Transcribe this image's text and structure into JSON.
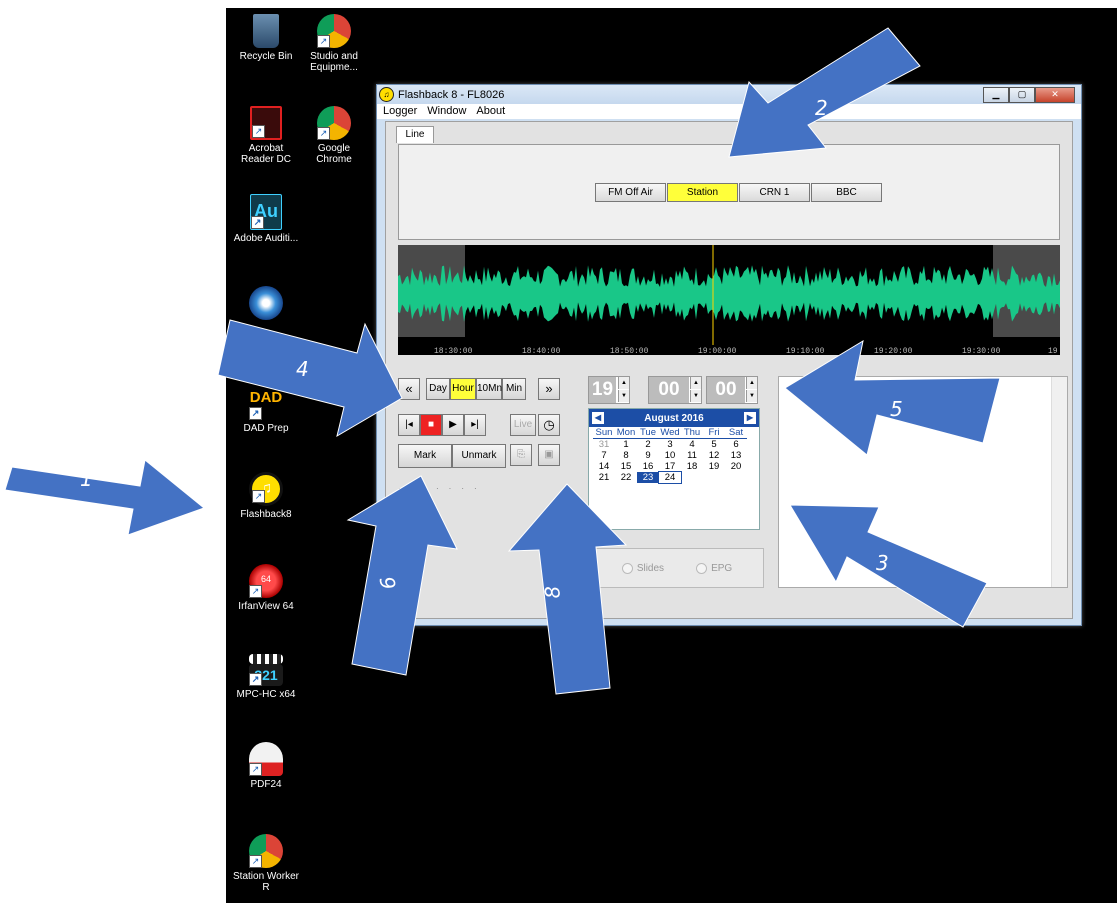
{
  "desktop": {
    "icons": [
      {
        "label": "Recycle Bin",
        "icon": "recycle-bin-icon"
      },
      {
        "label": "Studio and Equipme...",
        "icon": "chrome-icon"
      },
      {
        "label": "Acrobat Reader DC",
        "icon": "acrobat-icon"
      },
      {
        "label": "Google Chrome",
        "icon": "chrome-icon"
      },
      {
        "label": "Adobe Auditi...",
        "icon": "audition-icon"
      },
      {
        "label": "DAD Prep",
        "icon": "dad-icon"
      },
      {
        "label": "Flashback8",
        "icon": "flashback-icon"
      },
      {
        "label": "IrfanView 64",
        "icon": "irfanview-icon"
      },
      {
        "label": "MPC-HC x64",
        "icon": "mpc-icon"
      },
      {
        "label": "PDF24",
        "icon": "pdf24-icon"
      },
      {
        "label": "Station Worker R",
        "icon": "chrome-icon"
      }
    ]
  },
  "window": {
    "title": "Flashback 8 - FL8026",
    "menu": [
      "Logger",
      "Window",
      "About"
    ],
    "tab": "Line",
    "sources": [
      {
        "label": "FM Off Air",
        "active": false
      },
      {
        "label": "Station",
        "active": true
      },
      {
        "label": "CRN 1",
        "active": false
      },
      {
        "label": "BBC",
        "active": false
      }
    ],
    "timeline": [
      "18:30:00",
      "18:40:00",
      "18:50:00",
      "19:00:00",
      "19:10:00",
      "19:20:00",
      "19:30:00",
      "19"
    ],
    "zoom": [
      {
        "label": "Day",
        "active": false
      },
      {
        "label": "Hour",
        "active": true
      },
      {
        "label": "10Mn",
        "active": false
      },
      {
        "label": "Min",
        "active": false
      }
    ],
    "rewind": "«",
    "forward": "»",
    "transport": {
      "start": "|◂",
      "stop": "■",
      "play": "▶",
      "end": "▸|",
      "live": "Live",
      "clock": "◷"
    },
    "mark": "Mark",
    "unmark": "Unmark",
    "time": {
      "hours": "19",
      "minutes": "00",
      "seconds": "00"
    },
    "calendar": {
      "month": "August 2016",
      "days_of_week": [
        "Sun",
        "Mon",
        "Tue",
        "Wed",
        "Thu",
        "Fri",
        "Sat"
      ],
      "days": [
        "31",
        "1",
        "2",
        "3",
        "4",
        "5",
        "6",
        "7",
        "8",
        "9",
        "10",
        "11",
        "12",
        "13",
        "14",
        "15",
        "16",
        "17",
        "18",
        "19",
        "20",
        "21",
        "22",
        "23",
        "24"
      ],
      "selected": "23",
      "today": "24"
    },
    "radios": [
      "Slides",
      "EPG"
    ]
  },
  "annotations": [
    "1",
    "2",
    "3",
    "4",
    "5",
    "6",
    "8"
  ],
  "colors": {
    "arrow": "#4472c4",
    "highlight": "#ffff3a",
    "waveform": "#19c788",
    "calendar": "#1c4ea6"
  }
}
